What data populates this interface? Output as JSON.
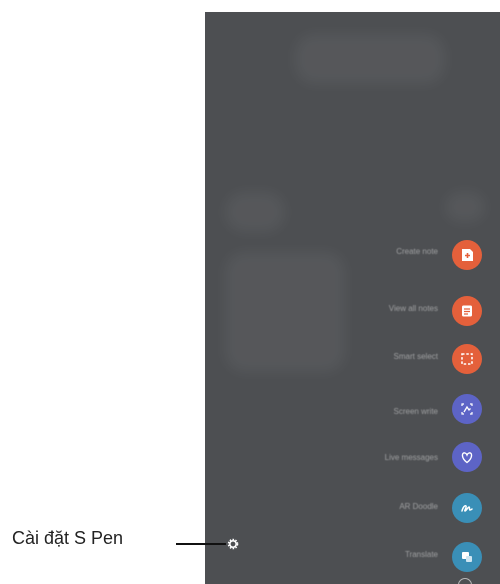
{
  "caption": {
    "text": "Cài đặt S Pen"
  },
  "menu": {
    "items": [
      {
        "label": "Create note",
        "icon": "create-note-icon",
        "color": "#e4603b"
      },
      {
        "label": "View all notes",
        "icon": "view-notes-icon",
        "color": "#e4603b"
      },
      {
        "label": "Smart select",
        "icon": "smart-select-icon",
        "color": "#e4603b"
      },
      {
        "label": "Screen write",
        "icon": "screen-write-icon",
        "color": "#5d64c6"
      },
      {
        "label": "Live messages",
        "icon": "live-messages-icon",
        "color": "#5d64c6"
      },
      {
        "label": "AR Doodle",
        "icon": "ar-doodle-icon",
        "color": "#3a8fb7"
      },
      {
        "label": "Translate",
        "icon": "translate-icon",
        "color": "#3a8fb7"
      }
    ]
  }
}
